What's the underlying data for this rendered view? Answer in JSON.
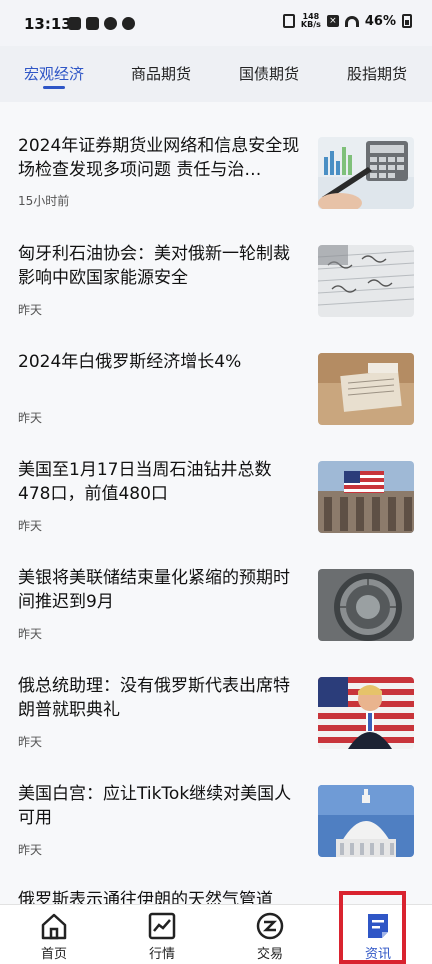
{
  "status_bar": {
    "time": "13:13",
    "net_speed_value": "148",
    "net_speed_unit": "KB/s",
    "battery": "46%"
  },
  "tabs": [
    {
      "label": "宏观经济",
      "active": true
    },
    {
      "label": "商品期货",
      "active": false
    },
    {
      "label": "国债期货",
      "active": false
    },
    {
      "label": "股指期货",
      "active": false
    }
  ],
  "news": [
    {
      "title": "2024年证券期货业网络和信息安全现场检查发现多项问题 责任与治…",
      "time": "15小时前",
      "image": "calculator-chart-photo"
    },
    {
      "title": "匈牙利石油协会：美对俄新一轮制裁影响中欧国家能源安全",
      "time": "昨天",
      "image": "handwritten-notes-photo"
    },
    {
      "title": "2024年白俄罗斯经济增长4%",
      "time": "昨天",
      "image": "papers-desk-photo"
    },
    {
      "title": "美国至1月17日当周石油钻井总数478口，前值480口",
      "time": "昨天",
      "image": "us-flag-building-photo"
    },
    {
      "title": "美银将美联储结束量化紧缩的预期时间推迟到9月",
      "time": "昨天",
      "image": "federal-reserve-seal-photo"
    },
    {
      "title": "俄总统助理：没有俄罗斯代表出席特朗普就职典礼",
      "time": "昨天",
      "image": "trump-speaking-photo"
    },
    {
      "title": "美国白宫：应让TikTok继续对美国人可用",
      "time": "昨天",
      "image": "capitol-dome-photo"
    },
    {
      "title": "俄罗斯表示通往伊朗的天然气管道",
      "time": "",
      "image": ""
    }
  ],
  "bottom_nav": [
    {
      "label": "首页",
      "icon": "home-icon",
      "active": false
    },
    {
      "label": "行情",
      "icon": "chart-icon",
      "active": false
    },
    {
      "label": "交易",
      "icon": "trade-icon",
      "active": false
    },
    {
      "label": "资讯",
      "icon": "news-icon",
      "active": true
    }
  ],
  "colors": {
    "accent": "#2f56c6",
    "highlight": "#d9232f"
  }
}
